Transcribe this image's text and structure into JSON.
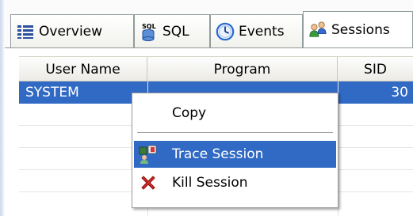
{
  "tabs": [
    {
      "label": "Overview",
      "icon": "overview-list-icon",
      "active": false
    },
    {
      "label": "SQL",
      "icon": "sql-database-icon",
      "active": false
    },
    {
      "label": "Events",
      "icon": "events-clock-icon",
      "active": false
    },
    {
      "label": "Sessions",
      "icon": "sessions-users-icon",
      "active": true
    }
  ],
  "table": {
    "headers": [
      "User Name",
      "Program",
      "SID"
    ],
    "rows": [
      {
        "user": "SYSTEM",
        "program": "",
        "sid": "30",
        "selected": true
      },
      {
        "user": "",
        "program": "",
        "sid": "",
        "selected": false
      },
      {
        "user": "",
        "program": "",
        "sid": "",
        "selected": false
      },
      {
        "user": "",
        "program": "",
        "sid": "",
        "selected": false
      },
      {
        "user": "",
        "program": "",
        "sid": "",
        "selected": false
      }
    ]
  },
  "context_menu": {
    "copy_label": "Copy",
    "trace_label": "Trace Session",
    "trace_icon": "trace-session-icon",
    "kill_label": "Kill Session",
    "kill_icon": "kill-session-red-x-icon"
  },
  "colors": {
    "selection": "#316ac5",
    "tab_border": "#919b9c"
  }
}
